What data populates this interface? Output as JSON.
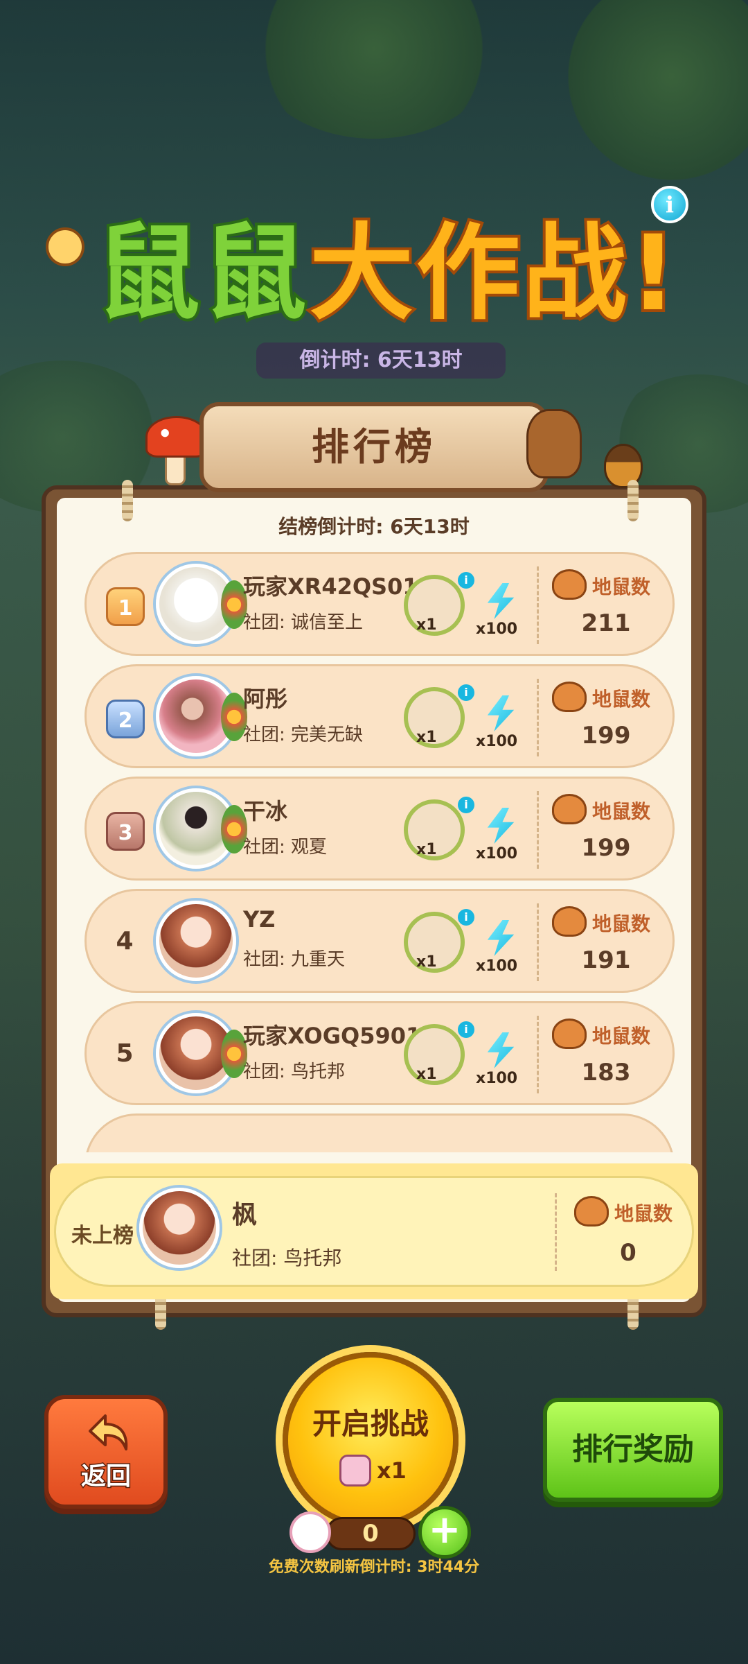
{
  "header": {
    "title_part1": "鼠鼠",
    "title_part2": "大作战!",
    "event_countdown": "倒计时: 6天13时",
    "info_icon": "info-icon"
  },
  "leaderboard": {
    "title": "排行榜",
    "countdown": "结榜倒计时: 6天13时",
    "score_label": "地鼠数",
    "rows": [
      {
        "rank": "1",
        "name": "玩家XR42QS01",
        "club": "社团: 诚信至上",
        "wreath_count": "x1",
        "bolt_count": "x100",
        "score": "211"
      },
      {
        "rank": "2",
        "name": "阿彤",
        "club": "社团: 完美无缺",
        "wreath_count": "x1",
        "bolt_count": "x100",
        "score": "199"
      },
      {
        "rank": "3",
        "name": "干冰",
        "club": "社团: 观夏",
        "wreath_count": "x1",
        "bolt_count": "x100",
        "score": "199"
      },
      {
        "rank": "4",
        "name": "YZ",
        "club": "社团: 九重天",
        "wreath_count": "x1",
        "bolt_count": "x100",
        "score": "191"
      },
      {
        "rank": "5",
        "name": "玩家XOGQ5901",
        "club": "社团: 鸟托邦",
        "wreath_count": "x1",
        "bolt_count": "x100",
        "score": "183"
      }
    ],
    "self": {
      "rank_text": "未上榜",
      "name": "枫",
      "club": "社团: 鸟托邦",
      "score": "0"
    }
  },
  "controls": {
    "back_label": "返回",
    "start_label": "开启挑战",
    "start_cost": "x1",
    "ticket_count": "0",
    "plus": "+",
    "refresh_note": "免费次数刷新倒计时: 3时44分",
    "reward_label": "排行奖励"
  },
  "colors": {
    "gold": "#f1a04a",
    "silver": "#7aa4da",
    "bronze": "#b8776a",
    "row_bg": "#fbe3c6",
    "self_bg": "#fff3b9",
    "reward_green": "#5ec318",
    "back_orange": "#e04b1f",
    "start_yellow": "#ffc20e"
  }
}
